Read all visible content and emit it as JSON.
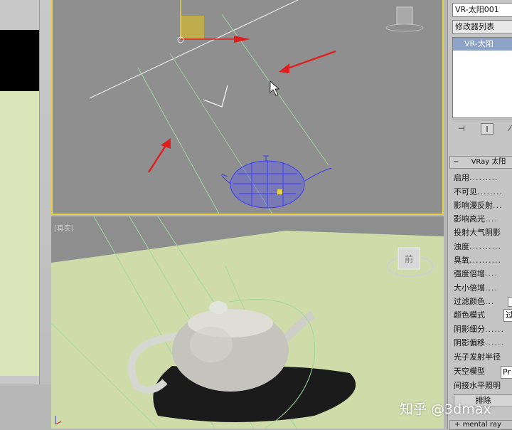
{
  "viewport_bottom": {
    "label": "[真实]"
  },
  "viewcube": {
    "face_label": "前"
  },
  "command_panel": {
    "object_name": "VR-太阳001",
    "modifier_list_label": "修改器列表",
    "modifier_stack": [
      "VR-太阳"
    ],
    "rollout_title": "VRay 太阳",
    "parameters": [
      "启用",
      "不可见",
      "影响漫反射",
      "影响高光",
      "投射大气阴影",
      "浊度",
      "臭氧",
      "强度倍增",
      "大小倍增",
      "过滤颜色",
      "颜色模式",
      "阴影细分",
      "阴影偏移",
      "光子发射半径",
      "天空模型",
      "间接水平照明"
    ],
    "color_mode_value": "过",
    "sky_model_value": "Pr",
    "exclude_button": "排除",
    "mental_ray_rollout": "mental ray"
  },
  "watermark": "知乎 @3dmax",
  "colors": {
    "viewport_bg": "#8f8f8f",
    "active_border": "#e6d23a",
    "ground": "#cfdca9",
    "teapot_wire": "#3a3aff",
    "arrow_red": "#e02020",
    "modifier_selected": "#8da2c7"
  }
}
